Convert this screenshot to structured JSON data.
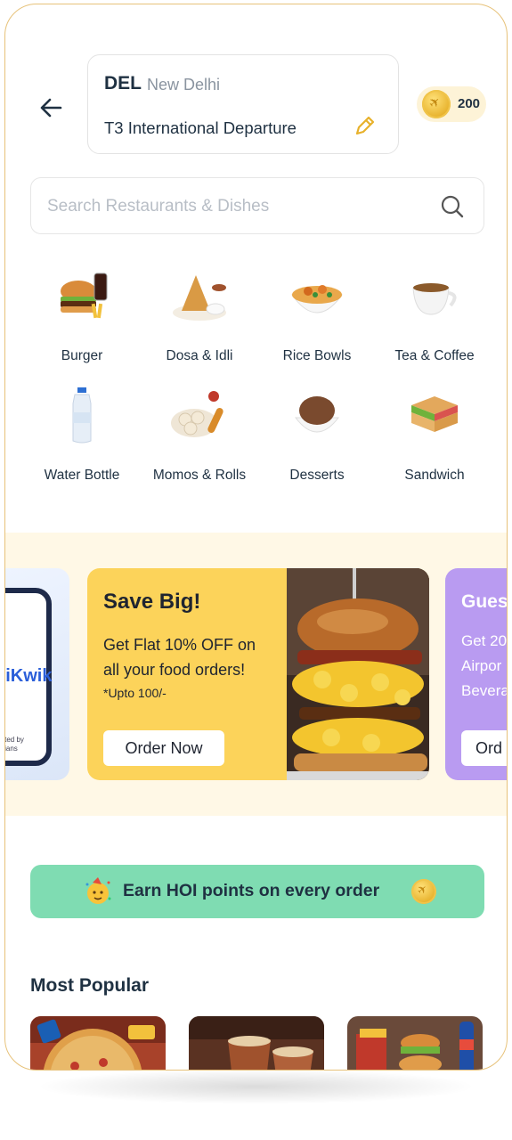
{
  "header": {
    "airport_code": "DEL",
    "city": "New Delhi",
    "terminal": "T3 International Departure",
    "points": "200"
  },
  "search": {
    "placeholder": "Search Restaurants & Dishes"
  },
  "categories": [
    {
      "label": "Burger",
      "icon": "burger-icon"
    },
    {
      "label": "Dosa & Idli",
      "icon": "dosa-icon"
    },
    {
      "label": "Rice Bowls",
      "icon": "rice-bowl-icon"
    },
    {
      "label": "Tea & Coffee",
      "icon": "coffee-cup-icon"
    },
    {
      "label": "Water Bottle",
      "icon": "water-bottle-icon"
    },
    {
      "label": "Momos & Rolls",
      "icon": "momos-icon"
    },
    {
      "label": "Desserts",
      "icon": "ice-cream-icon"
    },
    {
      "label": "Sandwich",
      "icon": "sandwich-icon"
    }
  ],
  "promos": {
    "prev": {
      "brand": "biKwik",
      "note_line1": "rusted by",
      "note_line2": "Indians"
    },
    "main": {
      "title": "Save Big!",
      "line1": "Get Flat 10% OFF on",
      "line2": "all your food orders!",
      "note": "*Upto 100/-",
      "button": "Order Now"
    },
    "next": {
      "title": "Gues",
      "line1": "Get 20",
      "line2": "Airpor",
      "line3": "Bevera",
      "button": "Ord"
    }
  },
  "earn_banner": {
    "text": "Earn HOI points on every order"
  },
  "most_popular": {
    "title": "Most Popular"
  },
  "colors": {
    "accent_yellow": "#fcd35a",
    "promo_purple": "#b99bf1",
    "earn_green": "#7fdcb2",
    "strip_bg": "#fff8e6",
    "text_dark": "#1f3142"
  }
}
